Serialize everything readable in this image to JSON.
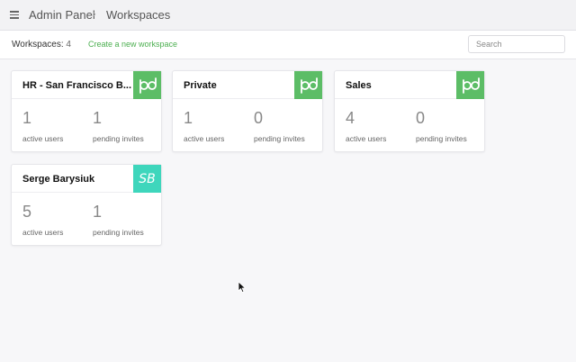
{
  "header": {
    "breadcrumb_root": "Admin Panel",
    "breadcrumb_sep": "›",
    "breadcrumb_current": "Workspaces"
  },
  "subbar": {
    "count_label": "Workspaces:",
    "count_value": "4",
    "create_link": "Create a new workspace",
    "search_placeholder": "Search"
  },
  "workspaces": [
    {
      "name": "HR - San Francisco B...",
      "logo": "pd-logo-icon",
      "logo_color": "#5cbd66",
      "active_users": "1",
      "active_label": "active users",
      "pending_invites": "1",
      "pending_label": "pending invites"
    },
    {
      "name": "Private",
      "logo": "pd-logo-icon",
      "logo_color": "#5cbd66",
      "active_users": "1",
      "active_label": "active users",
      "pending_invites": "0",
      "pending_label": "pending invites"
    },
    {
      "name": "Sales",
      "logo": "pd-logo-icon",
      "logo_color": "#5cbd66",
      "active_users": "4",
      "active_label": "active users",
      "pending_invites": "0",
      "pending_label": "pending invites"
    },
    {
      "name": "Serge Barysiuk",
      "logo_text": "SB",
      "logo_color": "#3ed6bc",
      "active_users": "5",
      "active_label": "active users",
      "pending_invites": "1",
      "pending_label": "pending invites"
    }
  ],
  "colors": {
    "accent_link": "#4caf50",
    "pd_green": "#5cbd66",
    "sb_teal": "#3ed6bc"
  }
}
